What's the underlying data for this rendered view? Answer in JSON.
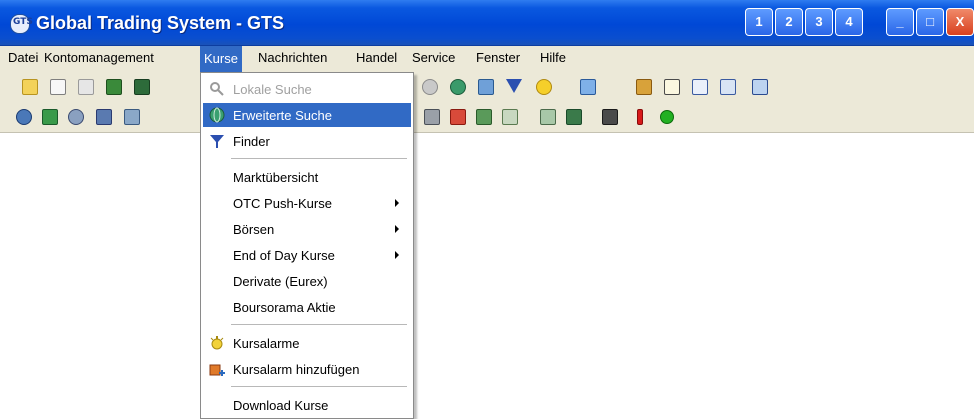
{
  "window": {
    "title": "Global Trading System - GTS",
    "app_icon_text": "GTS",
    "extra_buttons": [
      "1",
      "2",
      "3",
      "4"
    ],
    "controls": {
      "minimize": "_",
      "maximize": "□",
      "close": "X"
    }
  },
  "menubar": {
    "items": [
      "Datei",
      "Kontomanagement",
      "Kurse",
      "Nachrichten",
      "Handel",
      "Service",
      "Fenster",
      "Hilfe"
    ],
    "active": "Kurse"
  },
  "toolbar1_icons": [
    "new-document-icon",
    "open-document-icon",
    "page-icon",
    "image-icon",
    "screen-icon",
    "search-icon",
    "globe-icon",
    "chart-icon",
    "filter-icon",
    "star-icon",
    "window-icon",
    "bar-chart-icon",
    "table-icon",
    "document-icon",
    "export-icon",
    "window-stack-icon"
  ],
  "toolbar2_icons": [
    "database-icon",
    "people-icon",
    "network-icon",
    "otc-icon",
    "user-icon",
    "news-icon",
    "sd-icon",
    "market-icon",
    "list-icon",
    "person-icon",
    "group-icon",
    "tool-icon",
    "info-icon",
    "status-green-icon"
  ],
  "dropdown": {
    "items": [
      {
        "label": "Lokale Suche",
        "icon": "magnifier-icon",
        "state": "disabled"
      },
      {
        "label": "Erweiterte Suche",
        "icon": "globe-search-icon",
        "state": "selected"
      },
      {
        "label": "Finder",
        "icon": "funnel-icon",
        "state": "normal"
      },
      {
        "label": "Marktübersicht",
        "icon": "",
        "state": "normal"
      },
      {
        "label": "OTC Push-Kurse",
        "icon": "",
        "state": "normal",
        "submenu": true
      },
      {
        "label": "Börsen",
        "icon": "",
        "state": "normal",
        "submenu": true
      },
      {
        "label": "End of Day Kurse",
        "icon": "",
        "state": "normal",
        "submenu": true
      },
      {
        "label": "Derivate (Eurex)",
        "icon": "",
        "state": "normal"
      },
      {
        "label": "Boursorama Aktie",
        "icon": "",
        "state": "normal"
      },
      {
        "label": "Kursalarme",
        "icon": "alarm-icon",
        "state": "normal"
      },
      {
        "label": "Kursalarm hinzufügen",
        "icon": "add-alarm-icon",
        "state": "normal"
      },
      {
        "label": "Download Kurse",
        "icon": "",
        "state": "normal"
      }
    ]
  },
  "colors": {
    "selection": "#316ac5",
    "menu_bg": "#ece9d8",
    "title_blue": "#0048d6",
    "close_red": "#d8401f"
  }
}
